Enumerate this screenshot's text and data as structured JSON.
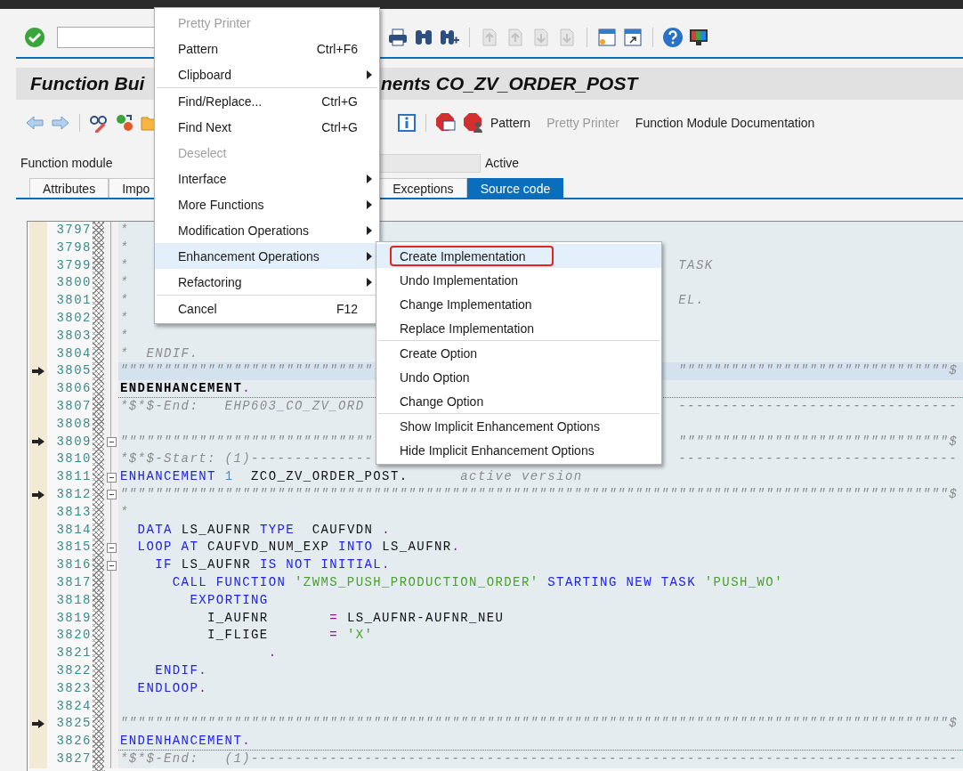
{
  "title_parts": [
    "Function Bui",
    "nents CO_ZV_ORDER_POST"
  ],
  "app_toolbar": {
    "buttons": [
      {
        "label": "Pattern",
        "disabled": false
      },
      {
        "label": "Pretty Printer",
        "disabled": true
      },
      {
        "label": "Function Module Documentation",
        "disabled": false
      }
    ]
  },
  "header": {
    "label": "Function module",
    "status": "Active"
  },
  "tabs": [
    {
      "label": "Attributes",
      "selected": false
    },
    {
      "label": "Impo",
      "selected": false
    },
    {
      "label": "Exceptions",
      "selected": false
    },
    {
      "label": "Source code",
      "selected": true
    }
  ],
  "editor": {
    "lines": [
      {
        "number": "3797",
        "marker": false,
        "fold": false,
        "highlighted": false,
        "separator_below": false,
        "tokens": [
          {
            "text": "*",
            "kind": "comment"
          }
        ]
      },
      {
        "number": "3798",
        "marker": false,
        "fold": false,
        "highlighted": false,
        "separator_below": false,
        "tokens": [
          {
            "text": "*",
            "kind": "comment"
          }
        ]
      },
      {
        "number": "3799",
        "marker": false,
        "fold": false,
        "highlighted": false,
        "separator_below": false,
        "tokens": [
          {
            "text": "*",
            "kind": "comment"
          },
          {
            "text": "                                                               TASK",
            "kind": "comment"
          }
        ]
      },
      {
        "number": "3800",
        "marker": false,
        "fold": false,
        "highlighted": false,
        "separator_below": false,
        "tokens": [
          {
            "text": "*",
            "kind": "comment"
          }
        ]
      },
      {
        "number": "3801",
        "marker": false,
        "fold": false,
        "highlighted": false,
        "separator_below": false,
        "tokens": [
          {
            "text": "*",
            "kind": "comment"
          },
          {
            "text": "                                                               EL.",
            "kind": "comment"
          }
        ]
      },
      {
        "number": "3802",
        "marker": false,
        "fold": false,
        "highlighted": false,
        "separator_below": false,
        "tokens": [
          {
            "text": "*",
            "kind": "comment"
          }
        ]
      },
      {
        "number": "3803",
        "marker": false,
        "fold": false,
        "highlighted": false,
        "separator_below": false,
        "tokens": [
          {
            "text": "*",
            "kind": "comment"
          }
        ]
      },
      {
        "number": "3804",
        "marker": false,
        "fold": false,
        "highlighted": false,
        "separator_below": false,
        "tokens": [
          {
            "text": "*  ENDIF.",
            "kind": "comment"
          }
        ]
      },
      {
        "number": "3805",
        "marker": true,
        "fold": false,
        "highlighted": true,
        "separator_below": false,
        "tokens": [
          {
            "text": "\"\"\"\"\"\"\"\"\"\"\"\"\"\"\"\"\"\"\"\"\"\"\"\"\"\"\"\"\"",
            "kind": "comment"
          },
          {
            "text": "                                   \"\"\"\"\"\"\"\"\"\"\"\"\"\"\"\"\"\"\"\"\"\"\"\"\"\"\"\"\"\"\"$",
            "kind": "comment"
          }
        ]
      },
      {
        "number": "3806",
        "marker": false,
        "fold": false,
        "highlighted": false,
        "separator_below": true,
        "tokens": [
          {
            "text": "ENDENHANCEMENT",
            "kind": "bold"
          },
          {
            "text": ".",
            "kind": "operator"
          }
        ]
      },
      {
        "number": "3807",
        "marker": false,
        "fold": false,
        "highlighted": false,
        "separator_below": false,
        "tokens": [
          {
            "text": "*$*$-End:   EHP603_CO_ZV_ORD",
            "kind": "comment"
          },
          {
            "text": "                                    --------------------------------",
            "kind": "comment"
          }
        ]
      },
      {
        "number": "3808",
        "marker": false,
        "fold": false,
        "highlighted": false,
        "separator_below": false
      },
      {
        "number": "3809",
        "marker": true,
        "fold": true,
        "highlighted": false,
        "separator_below": false,
        "tokens": [
          {
            "text": "\"\"\"\"\"\"\"\"\"\"\"\"\"\"\"\"\"\"\"\"\"\"\"\"\"\"\"\"\"",
            "kind": "comment"
          },
          {
            "text": "                                   \"\"\"\"\"\"\"\"\"\"\"\"\"\"\"\"\"\"\"\"\"\"\"\"\"\"\"\"\"\"\"$",
            "kind": "comment"
          }
        ]
      },
      {
        "number": "3810",
        "marker": false,
        "fold": false,
        "highlighted": false,
        "separator_below": false,
        "tokens": [
          {
            "text": "*$*$-Start: (1)--------------",
            "kind": "comment"
          },
          {
            "text": "                                   --------------------------------",
            "kind": "comment"
          }
        ]
      },
      {
        "number": "3811",
        "marker": false,
        "fold": true,
        "highlighted": false,
        "separator_below": false,
        "tokens": [
          {
            "text": "ENHANCEMENT",
            "kind": "keyword"
          },
          {
            "text": " 1",
            "kind": "number"
          },
          {
            "text": "  ZCO_ZV_ORDER_POST.",
            "kind": "plain"
          },
          {
            "text": "      active version",
            "kind": "comment"
          }
        ]
      },
      {
        "number": "3812",
        "marker": true,
        "fold": true,
        "highlighted": false,
        "separator_below": false,
        "tokens": [
          {
            "text": "\"\"\"\"\"\"\"\"\"\"\"\"\"\"\"\"\"\"\"\"\"\"\"\"\"\"\"\"\"\"\"\"\"\"\"\"\"\"\"\"\"\"\"\"\"\"\"\"\"\"\"\"\"\"\"\"\"\"\"\"\"\"\"\"\"\"\"\"\"\"\"\"\"\"\"\"\"\"\"\"\"\"\"\"\"\"\"\"\"\"\"\"\"\"\"$",
            "kind": "comment"
          }
        ]
      },
      {
        "number": "3813",
        "marker": false,
        "fold": false,
        "highlighted": false,
        "separator_below": false,
        "tokens": [
          {
            "text": "*",
            "kind": "comment"
          }
        ]
      },
      {
        "number": "3814",
        "marker": false,
        "fold": false,
        "highlighted": false,
        "separator_below": false,
        "tokens": [
          {
            "text": "  DATA",
            "kind": "keyword"
          },
          {
            "text": " LS_AUFNR ",
            "kind": "plain"
          },
          {
            "text": "TYPE",
            "kind": "keyword"
          },
          {
            "text": "  CAUFVDN ",
            "kind": "plain"
          },
          {
            "text": ".",
            "kind": "operator"
          }
        ]
      },
      {
        "number": "3815",
        "marker": false,
        "fold": true,
        "highlighted": false,
        "separator_below": false,
        "tokens": [
          {
            "text": "  LOOP AT",
            "kind": "keyword"
          },
          {
            "text": " CAUFVD_NUM_EXP ",
            "kind": "plain"
          },
          {
            "text": "INTO",
            "kind": "keyword"
          },
          {
            "text": " LS_AUFNR",
            "kind": "plain"
          },
          {
            "text": ".",
            "kind": "operator"
          }
        ]
      },
      {
        "number": "3816",
        "marker": false,
        "fold": true,
        "highlighted": false,
        "separator_below": false,
        "tokens": [
          {
            "text": "    IF",
            "kind": "keyword"
          },
          {
            "text": " LS_AUFNR ",
            "kind": "plain"
          },
          {
            "text": "IS NOT INITIAL",
            "kind": "keyword"
          },
          {
            "text": ".",
            "kind": "operator"
          }
        ]
      },
      {
        "number": "3817",
        "marker": false,
        "fold": false,
        "highlighted": false,
        "separator_below": false,
        "tokens": [
          {
            "text": "      CALL FUNCTION",
            "kind": "keyword"
          },
          {
            "text": " 'ZWMS_PUSH_PRODUCTION_ORDER'",
            "kind": "string"
          },
          {
            "text": " STARTING NEW TASK",
            "kind": "keyword"
          },
          {
            "text": " 'PUSH_WO'",
            "kind": "string"
          }
        ]
      },
      {
        "number": "3818",
        "marker": false,
        "fold": false,
        "highlighted": false,
        "separator_below": false,
        "tokens": [
          {
            "text": "        EXPORTING",
            "kind": "keyword"
          }
        ]
      },
      {
        "number": "3819",
        "marker": false,
        "fold": false,
        "highlighted": false,
        "separator_below": false,
        "tokens": [
          {
            "text": "          I_AUFNR",
            "kind": "plain"
          },
          {
            "text": "       =",
            "kind": "operator"
          },
          {
            "text": " LS_AUFNR-AUFNR_NEU",
            "kind": "plain"
          }
        ]
      },
      {
        "number": "3820",
        "marker": false,
        "fold": false,
        "highlighted": false,
        "separator_below": false,
        "tokens": [
          {
            "text": "          I_FLIGE",
            "kind": "plain"
          },
          {
            "text": "       =",
            "kind": "operator"
          },
          {
            "text": " 'X'",
            "kind": "string"
          }
        ]
      },
      {
        "number": "3821",
        "marker": false,
        "fold": false,
        "highlighted": false,
        "separator_below": false,
        "tokens": [
          {
            "text": "                 .",
            "kind": "operator"
          }
        ]
      },
      {
        "number": "3822",
        "marker": false,
        "fold": false,
        "highlighted": false,
        "separator_below": false,
        "tokens": [
          {
            "text": "    ENDIF",
            "kind": "keyword"
          },
          {
            "text": ".",
            "kind": "operator"
          }
        ]
      },
      {
        "number": "3823",
        "marker": false,
        "fold": false,
        "highlighted": false,
        "separator_below": false,
        "tokens": [
          {
            "text": "  ENDLOOP",
            "kind": "keyword"
          },
          {
            "text": ".",
            "kind": "operator"
          }
        ]
      },
      {
        "number": "3824",
        "marker": false,
        "fold": false,
        "highlighted": false,
        "separator_below": false
      },
      {
        "number": "3825",
        "marker": true,
        "fold": false,
        "highlighted": false,
        "separator_below": false,
        "tokens": [
          {
            "text": "\"\"\"\"\"\"\"\"\"\"\"\"\"\"\"\"\"\"\"\"\"\"\"\"\"\"\"\"\"\"\"\"\"\"\"\"\"\"\"\"\"\"\"\"\"\"\"\"\"\"\"\"\"\"\"\"\"\"\"\"\"\"\"\"\"\"\"\"\"\"\"\"\"\"\"\"\"\"\"\"\"\"\"\"\"\"\"\"\"\"\"\"\"\"\"$",
            "kind": "comment"
          }
        ]
      },
      {
        "number": "3826",
        "marker": false,
        "fold": false,
        "highlighted": false,
        "separator_below": true,
        "tokens": [
          {
            "text": "ENDENHANCEMENT",
            "kind": "keyword"
          },
          {
            "text": ".",
            "kind": "operator"
          }
        ]
      },
      {
        "number": "3827",
        "marker": false,
        "fold": false,
        "highlighted": false,
        "separator_below": false,
        "tokens": [
          {
            "text": "*$*$-End:   (1)---------------------------------------------------------------------------------",
            "kind": "comment"
          }
        ]
      }
    ]
  },
  "context_menu": {
    "groups": [
      {
        "items": [
          {
            "label": "Pretty Printer",
            "disabled": true,
            "submenu": false,
            "selected": false
          },
          {
            "label": "Pattern",
            "shortcut": "Ctrl+F6",
            "disabled": false,
            "submenu": false,
            "selected": false
          },
          {
            "label": "Clipboard",
            "disabled": false,
            "submenu": true,
            "selected": false
          }
        ]
      },
      {
        "items": [
          {
            "label": "Find/Replace...",
            "shortcut": "Ctrl+G",
            "disabled": false,
            "submenu": false,
            "selected": false
          },
          {
            "label": "Find Next",
            "shortcut": "Ctrl+G",
            "disabled": false,
            "submenu": false,
            "selected": false
          },
          {
            "label": "Deselect",
            "disabled": true,
            "submenu": false,
            "selected": false
          },
          {
            "label": "Interface",
            "disabled": false,
            "submenu": true,
            "selected": false
          },
          {
            "label": "More Functions",
            "disabled": false,
            "submenu": true,
            "selected": false
          },
          {
            "label": "Modification Operations",
            "disabled": false,
            "submenu": true,
            "selected": false
          },
          {
            "label": "Enhancement Operations",
            "disabled": false,
            "submenu": true,
            "selected": true
          },
          {
            "label": "Refactoring",
            "disabled": false,
            "submenu": true,
            "selected": false
          }
        ]
      },
      {
        "items": [
          {
            "label": "Cancel",
            "shortcut": "F12",
            "disabled": false,
            "submenu": false,
            "selected": false
          }
        ]
      }
    ]
  },
  "submenu": {
    "groups": [
      {
        "items": [
          {
            "label": "Create Implementation",
            "selected": true,
            "outlined": true
          },
          {
            "label": "Undo Implementation",
            "selected": false,
            "outlined": false
          },
          {
            "label": "Change Implementation",
            "selected": false,
            "outlined": false
          },
          {
            "label": "Replace Implementation",
            "selected": false,
            "outlined": false
          }
        ]
      },
      {
        "items": [
          {
            "label": "Create Option",
            "selected": false,
            "outlined": false
          },
          {
            "label": "Undo Option",
            "selected": false,
            "outlined": false
          },
          {
            "label": "Change Option",
            "selected": false,
            "outlined": false
          }
        ]
      },
      {
        "items": [
          {
            "label": "Show Implicit Enhancement Options",
            "selected": false,
            "outlined": false
          },
          {
            "label": "Hide Implicit Enhancement Options",
            "selected": false,
            "outlined": false
          }
        ]
      }
    ]
  }
}
